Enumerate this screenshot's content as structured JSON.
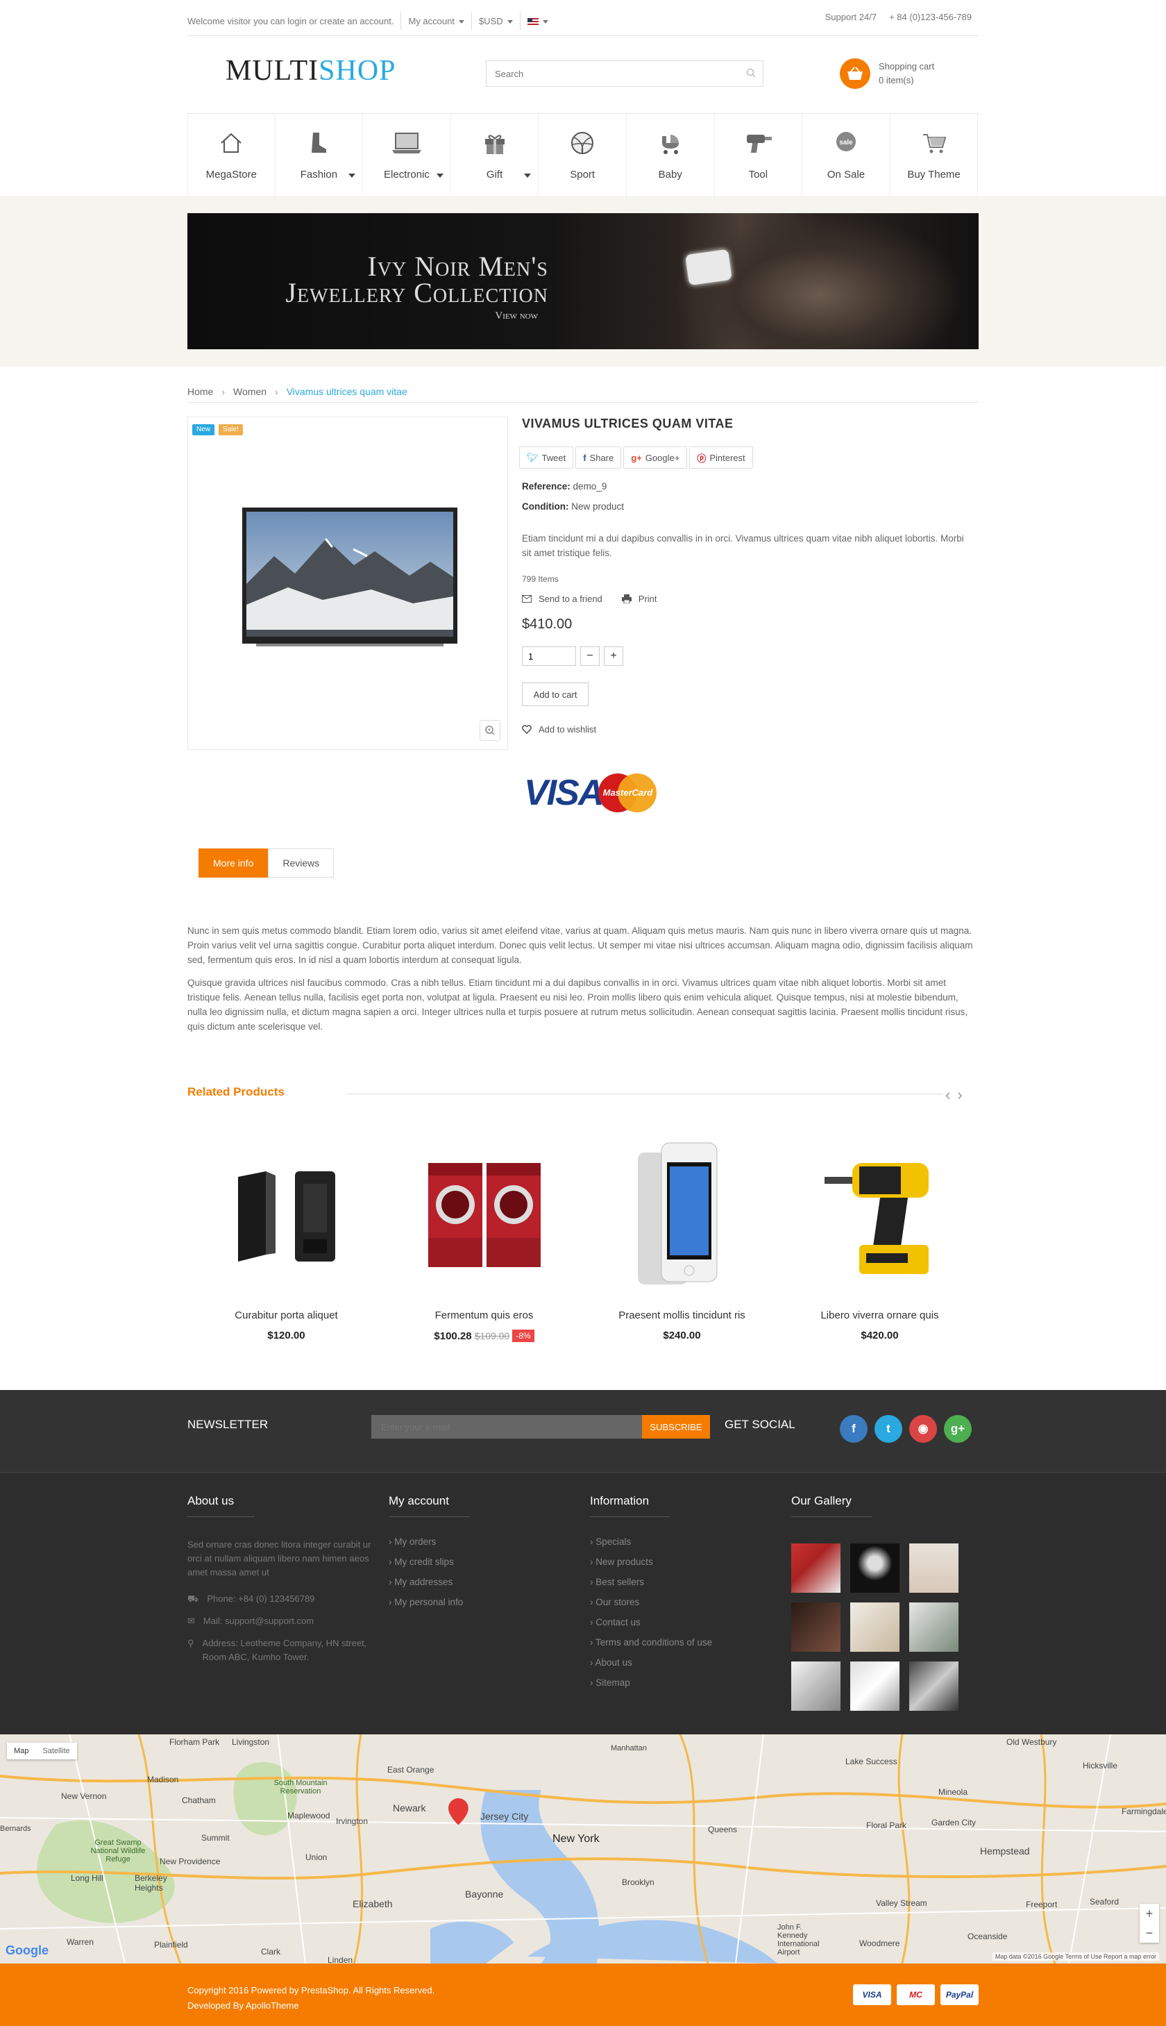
{
  "topbar": {
    "welcome": "Welcome visitor you can login or create an account.",
    "my_account": "My account",
    "currency": "$USD",
    "support": "Support 24/7",
    "phone": "+ 84 (0)123-456-789"
  },
  "header": {
    "logo_part1": "MULTI",
    "logo_part2": "SHOP",
    "search_placeholder": "Search",
    "cart_title": "Shopping cart",
    "cart_count": "0 item(s)"
  },
  "menu": [
    {
      "label": "MegaStore",
      "icon": "house-icon",
      "dropdown": false
    },
    {
      "label": "Fashion",
      "icon": "boot-icon",
      "dropdown": true
    },
    {
      "label": "Electronic",
      "icon": "laptop-icon",
      "dropdown": true
    },
    {
      "label": "Gift",
      "icon": "gift-icon",
      "dropdown": true
    },
    {
      "label": "Sport",
      "icon": "ball-icon",
      "dropdown": false
    },
    {
      "label": "Baby",
      "icon": "stroller-icon",
      "dropdown": false
    },
    {
      "label": "Tool",
      "icon": "drill-icon",
      "dropdown": false
    },
    {
      "label": "On Sale",
      "icon": "sale-tag-icon",
      "dropdown": false
    },
    {
      "label": "Buy Theme",
      "icon": "cart-icon",
      "dropdown": false
    }
  ],
  "banner": {
    "line1": "Ivy Noir Men's",
    "line2": "Jewellery Collection",
    "cta": "View now"
  },
  "breadcrumb": {
    "home": "Home",
    "category": "Women",
    "current": "Vivamus ultrices quam vitae"
  },
  "product": {
    "badge_new": "New",
    "badge_sale": "Sale!",
    "title": "VIVAMUS ULTRICES QUAM VITAE",
    "share": {
      "tweet": "Tweet",
      "share": "Share",
      "google": "Google+",
      "pinterest": "Pinterest"
    },
    "reference_label": "Reference:",
    "reference_value": "demo_9",
    "condition_label": "Condition:",
    "condition_value": "New product",
    "description": "Etiam tincidunt mi a dui dapibus convallis in in orci. Vivamus ultrices quam vitae nibh aliquet lobortis. Morbi sit amet tristique felis.",
    "stock": "799 Items",
    "send_friend": "Send to a friend",
    "print": "Print",
    "price": "$410.00",
    "quantity": "1",
    "add_to_cart": "Add to cart",
    "wishlist": "Add to wishlist",
    "visa": "VISA",
    "mastercard": "MasterCard"
  },
  "tabs": {
    "more_info": "More info",
    "reviews": "Reviews",
    "para1": "Nunc in sem quis metus commodo blandit. Etiam lorem odio, varius sit amet eleifend vitae, varius at quam. Aliquam quis metus mauris. Nam quis nunc in libero viverra ornare quis ut magna. Proin varius velit vel urna sagittis congue. Curabitur porta aliquet interdum. Donec quis velit lectus. Ut semper mi vitae nisi ultrices accumsan. Aliquam magna odio, dignissim facilisis aliquam sed, fermentum quis eros. In id nisl a quam lobortis interdum at consequat ligula.",
    "para2": "Quisque gravida ultrices nisl faucibus commodo. Cras a nibh tellus. Etiam tincidunt mi a dui dapibus convallis in in orci. Vivamus ultrices quam vitae nibh aliquet lobortis. Morbi sit amet tristique felis. Aenean tellus nulla, facilisis eget porta non, volutpat at ligula. Praesent eu nisi leo. Proin mollis libero quis enim vehicula aliquet. Quisque tempus, nisi at molestie bibendum, nulla leo dignissim nulla, et dictum magna sapien a orci. Integer ultrices nulla et turpis posuere at rutrum metus sollicitudin. Aenean consequat sagittis lacinia. Praesent mollis tincidunt risus, quis dictum ante scelerisque vel."
  },
  "related": {
    "heading": "Related Products",
    "items": [
      {
        "name": "Curabitur porta aliquet",
        "price": "$120.00",
        "old_price": "",
        "discount": ""
      },
      {
        "name": "Fermentum quis eros",
        "price": "$100.28",
        "old_price": "$109.00",
        "discount": "-8%"
      },
      {
        "name": "Praesent mollis tincidunt ris",
        "price": "$240.00",
        "old_price": "",
        "discount": ""
      },
      {
        "name": "Libero viverra ornare quis",
        "price": "$420.00",
        "old_price": "",
        "discount": ""
      }
    ]
  },
  "footer": {
    "newsletter": "NEWSLETTER",
    "email_placeholder": "Enter your e-mail",
    "subscribe": "SUBSCRIBE",
    "get_social": "GET SOCIAL",
    "about": {
      "title": "About us",
      "text": "Sed ornare cras donec litora integer curabit ur orci at nullam aliquam libero nam himen aeos amet massa amet ut",
      "phone": "Phone: +84 (0) 123456789",
      "mail": "Mail: support@support.com",
      "address": "Address: Leotheme Company, HN street, Room ABC, Kumho Tower."
    },
    "account": {
      "title": "My account",
      "links": [
        "My orders",
        "My credit slips",
        "My addresses",
        "My personal info"
      ]
    },
    "information": {
      "title": "Information",
      "links": [
        "Specials",
        "New products",
        "Best sellers",
        "Our stores",
        "Contact us",
        "Terms and conditions of use",
        "About us",
        "Sitemap"
      ]
    },
    "gallery": {
      "title": "Our Gallery"
    }
  },
  "map": {
    "tab_map": "Map",
    "tab_satellite": "Satellite",
    "labels": [
      "Florham Park",
      "Livingston",
      "East Orange",
      "Madison",
      "New Vernon",
      "Chatham",
      "South Mountain Reservation",
      "Maplewood",
      "Irvington",
      "Newark",
      "Jersey City",
      "New York",
      "Summit",
      "Union",
      "Great Swamp National Wildlife Refuge",
      "Long Hill",
      "New Providence",
      "Berkeley Heights",
      "Bayonne",
      "Elizabeth",
      "Warren",
      "Plainfield",
      "Clark",
      "Linden",
      "Brooklyn",
      "Queens",
      "Lake Success",
      "Mineola",
      "Old Westbury",
      "Hicksville",
      "Garden City",
      "Hempstead",
      "Farmingdale",
      "Floral Park",
      "Freeport",
      "Valley Stream",
      "Seaford",
      "Oceanside",
      "Woodmere",
      "John F. Kennedy International Airport",
      "Bernards",
      "Manhattan"
    ],
    "copyright": "Map data ©2016 Google   Terms of Use   Report a map error",
    "google": "Google"
  },
  "bottom": {
    "copyright": "Copyright 2016 Powered by PrestaShop. All Rights Reserved.",
    "developed": "Developed By ApolloTheme",
    "pay1": "VISA",
    "pay2": "MC",
    "pay3": "PayPal"
  }
}
